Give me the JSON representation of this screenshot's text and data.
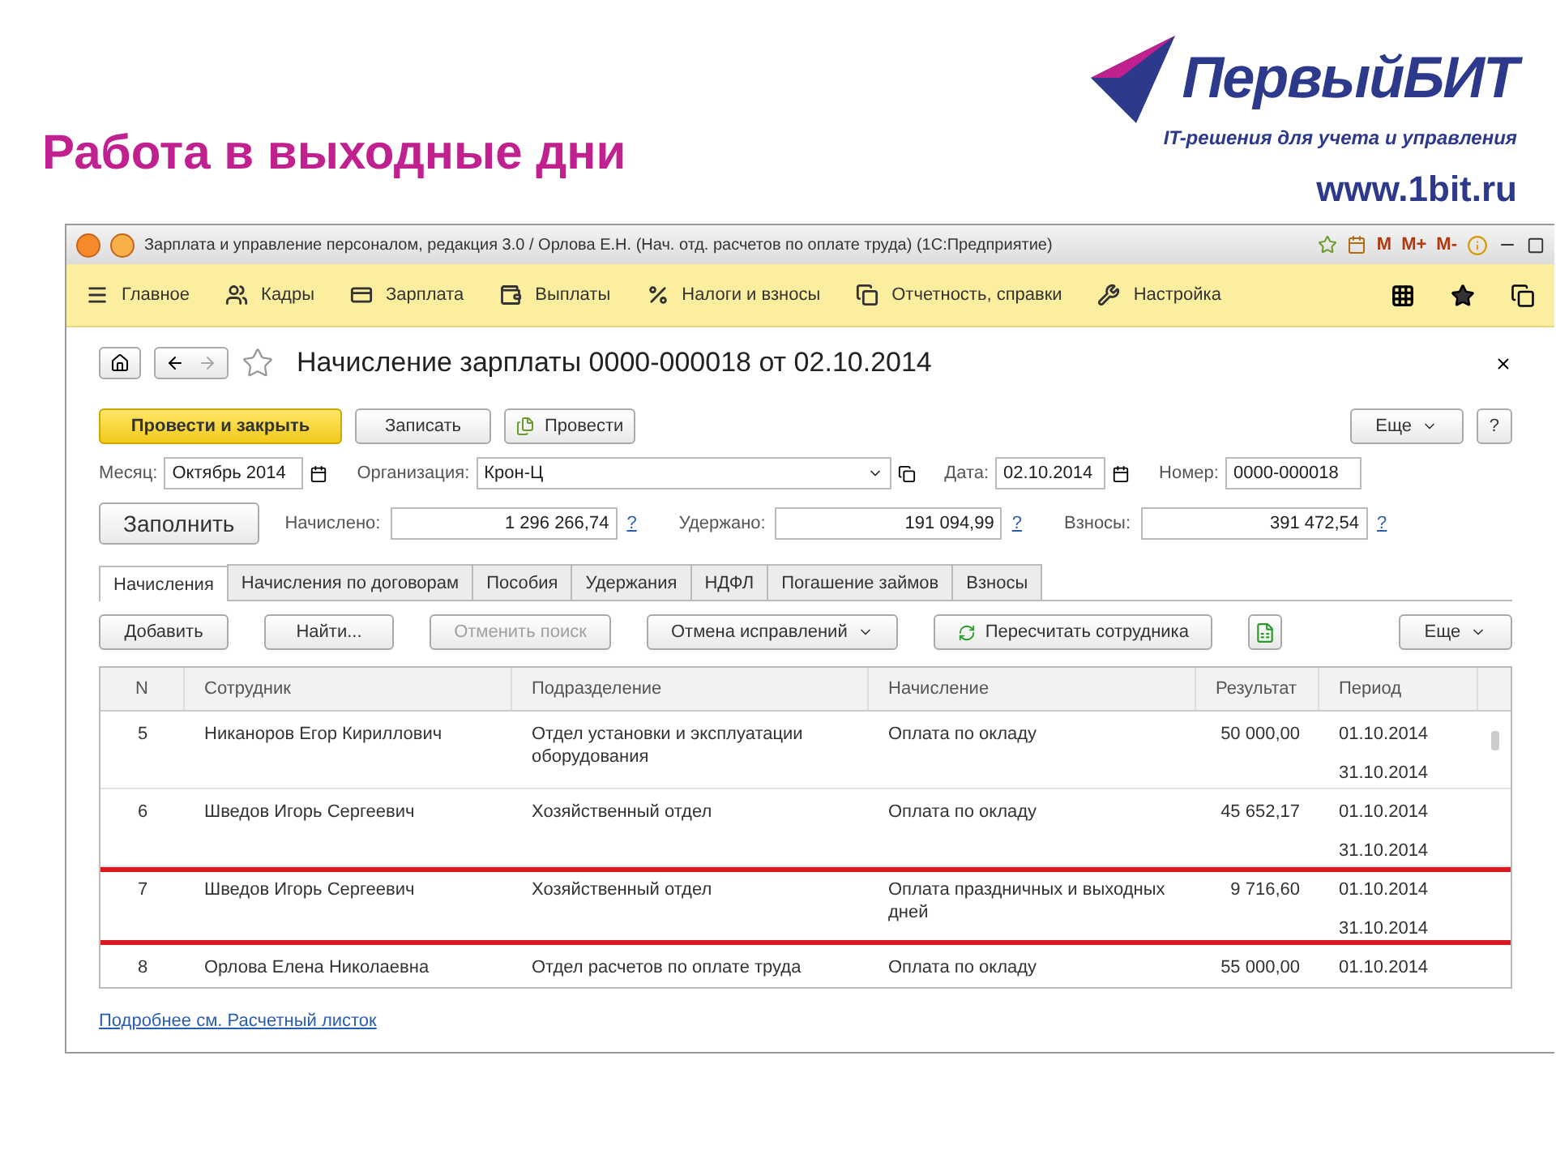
{
  "slide": {
    "title": "Работа в выходные дни",
    "logo": {
      "name": "ПервыйБИТ",
      "tagline": "IT-решения для учета и управления",
      "url": "www.1bit.ru"
    }
  },
  "window": {
    "title": "Зарплата и управление персоналом, редакция 3.0 / Орлова Е.Н. (Нач. отд. расчетов по оплате труда)  (1С:Предприятие)",
    "tools": [
      "M",
      "M+",
      "M-"
    ]
  },
  "menu": [
    {
      "label": "Главное"
    },
    {
      "label": "Кадры"
    },
    {
      "label": "Зарплата"
    },
    {
      "label": "Выплаты"
    },
    {
      "label": "Налоги и взносы"
    },
    {
      "label": "Отчетность, справки"
    },
    {
      "label": "Настройка"
    }
  ],
  "document": {
    "title": "Начисление зарплаты 0000-000018 от 02.10.2014",
    "commands": [
      {
        "label": "Провести и закрыть",
        "kind": "primary"
      },
      {
        "label": "Записать",
        "kind": "normal"
      },
      {
        "label": "Провести",
        "kind": "icon"
      }
    ],
    "more": "Еще",
    "help": "?",
    "fields": [
      {
        "label": "Месяц:",
        "value": "Октябрь 2014",
        "kind": "month"
      },
      {
        "label": "Организация:",
        "value": "Крон-Ц",
        "kind": "select"
      },
      {
        "label": "Дата:",
        "value": "02.10.2014",
        "kind": "date"
      },
      {
        "label": "Номер:",
        "value": "0000-000018",
        "kind": "text"
      }
    ],
    "fill_button": "Заполнить",
    "totals": [
      {
        "label": "Начислено:",
        "value": "1 296 266,74",
        "help": "?"
      },
      {
        "label": "Удержано:",
        "value": "191 094,99",
        "help": "?"
      },
      {
        "label": "Взносы:",
        "value": "391 472,54",
        "help": "?"
      }
    ]
  },
  "tabs": [
    {
      "label": "Начисления",
      "selected": true
    },
    {
      "label": "Начисления по договорам",
      "selected": false
    },
    {
      "label": "Пособия",
      "selected": false
    },
    {
      "label": "Удержания",
      "selected": false
    },
    {
      "label": "НДФЛ",
      "selected": false
    },
    {
      "label": "Погашение займов",
      "selected": false
    },
    {
      "label": "Взносы",
      "selected": false
    }
  ],
  "table_toolbar": [
    {
      "label": "Добавить",
      "kind": "normal",
      "disabled": false
    },
    {
      "label": "Найти...",
      "kind": "normal",
      "disabled": false
    },
    {
      "label": "Отменить поиск",
      "kind": "normal",
      "disabled": true
    },
    {
      "label": "Отмена исправлений",
      "kind": "dropdown",
      "disabled": false
    },
    {
      "label": "Пересчитать сотрудника",
      "kind": "refresh",
      "disabled": false
    },
    {
      "kind": "add-icon",
      "disabled": false
    }
  ],
  "table_more": "Еще",
  "table": {
    "columns": [
      "N",
      "Сотрудник",
      "Подразделение",
      "Начисление",
      "Результат",
      "Период"
    ],
    "rows": [
      {
        "n": "5",
        "employee": "Никаноров Егор Кириллович",
        "department": "Отдел установки и эксплуатации оборудования",
        "accrual": "Оплата по окладу",
        "result": "50 000,00",
        "period": [
          "01.10.2014",
          "31.10.2014"
        ],
        "highlighted": false
      },
      {
        "n": "6",
        "employee": "Шведов Игорь Сергеевич",
        "department": "Хозяйственный отдел",
        "accrual": "Оплата по окладу",
        "result": "45 652,17",
        "period": [
          "01.10.2014",
          "31.10.2014"
        ],
        "highlighted": false
      },
      {
        "n": "7",
        "employee": "Шведов Игорь Сергеевич",
        "department": "Хозяйственный отдел",
        "accrual": "Оплата праздничных и выходных дней",
        "result": "9 716,60",
        "period": [
          "01.10.2014",
          "31.10.2014"
        ],
        "highlighted": true
      },
      {
        "n": "8",
        "employee": "Орлова Елена Николаевна",
        "department": "Отдел расчетов по оплате труда",
        "accrual": "Оплата по окладу",
        "result": "55 000,00",
        "period": [
          "01.10.2014"
        ],
        "highlighted": false
      }
    ]
  },
  "footer_link": "Подробнее см. Расчетный листок"
}
